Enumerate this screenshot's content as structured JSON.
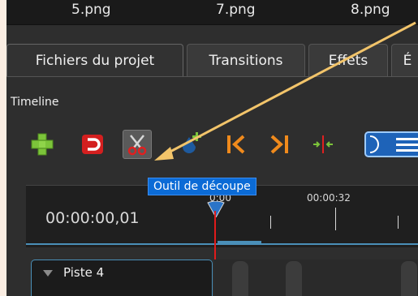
{
  "files": {
    "labels": [
      "5.png",
      "7.png",
      "8.png"
    ]
  },
  "tabs": [
    {
      "label": "Fichiers du projet"
    },
    {
      "label": "Transitions"
    },
    {
      "label": "Effets"
    },
    {
      "label": "É"
    }
  ],
  "timeline": {
    "title": "Timeline",
    "time_readout": "00:00:00,01",
    "ruler_labels": [
      "0:00",
      "00:00:32"
    ],
    "track_name": "Piste 4"
  },
  "toolbar": {
    "tooltip": "Outil de découpe",
    "icons": [
      "add-track-icon",
      "magnet-icon",
      "razor-icon",
      "add-marker-icon",
      "previous-marker-icon",
      "next-marker-icon",
      "center-playhead-icon",
      "zoom-icon"
    ]
  },
  "colors": {
    "accent": "#0b6bd6",
    "playhead": "#e01b1b",
    "track_border": "#4a8fb8",
    "annotation_arrow": "#f2c46a"
  }
}
